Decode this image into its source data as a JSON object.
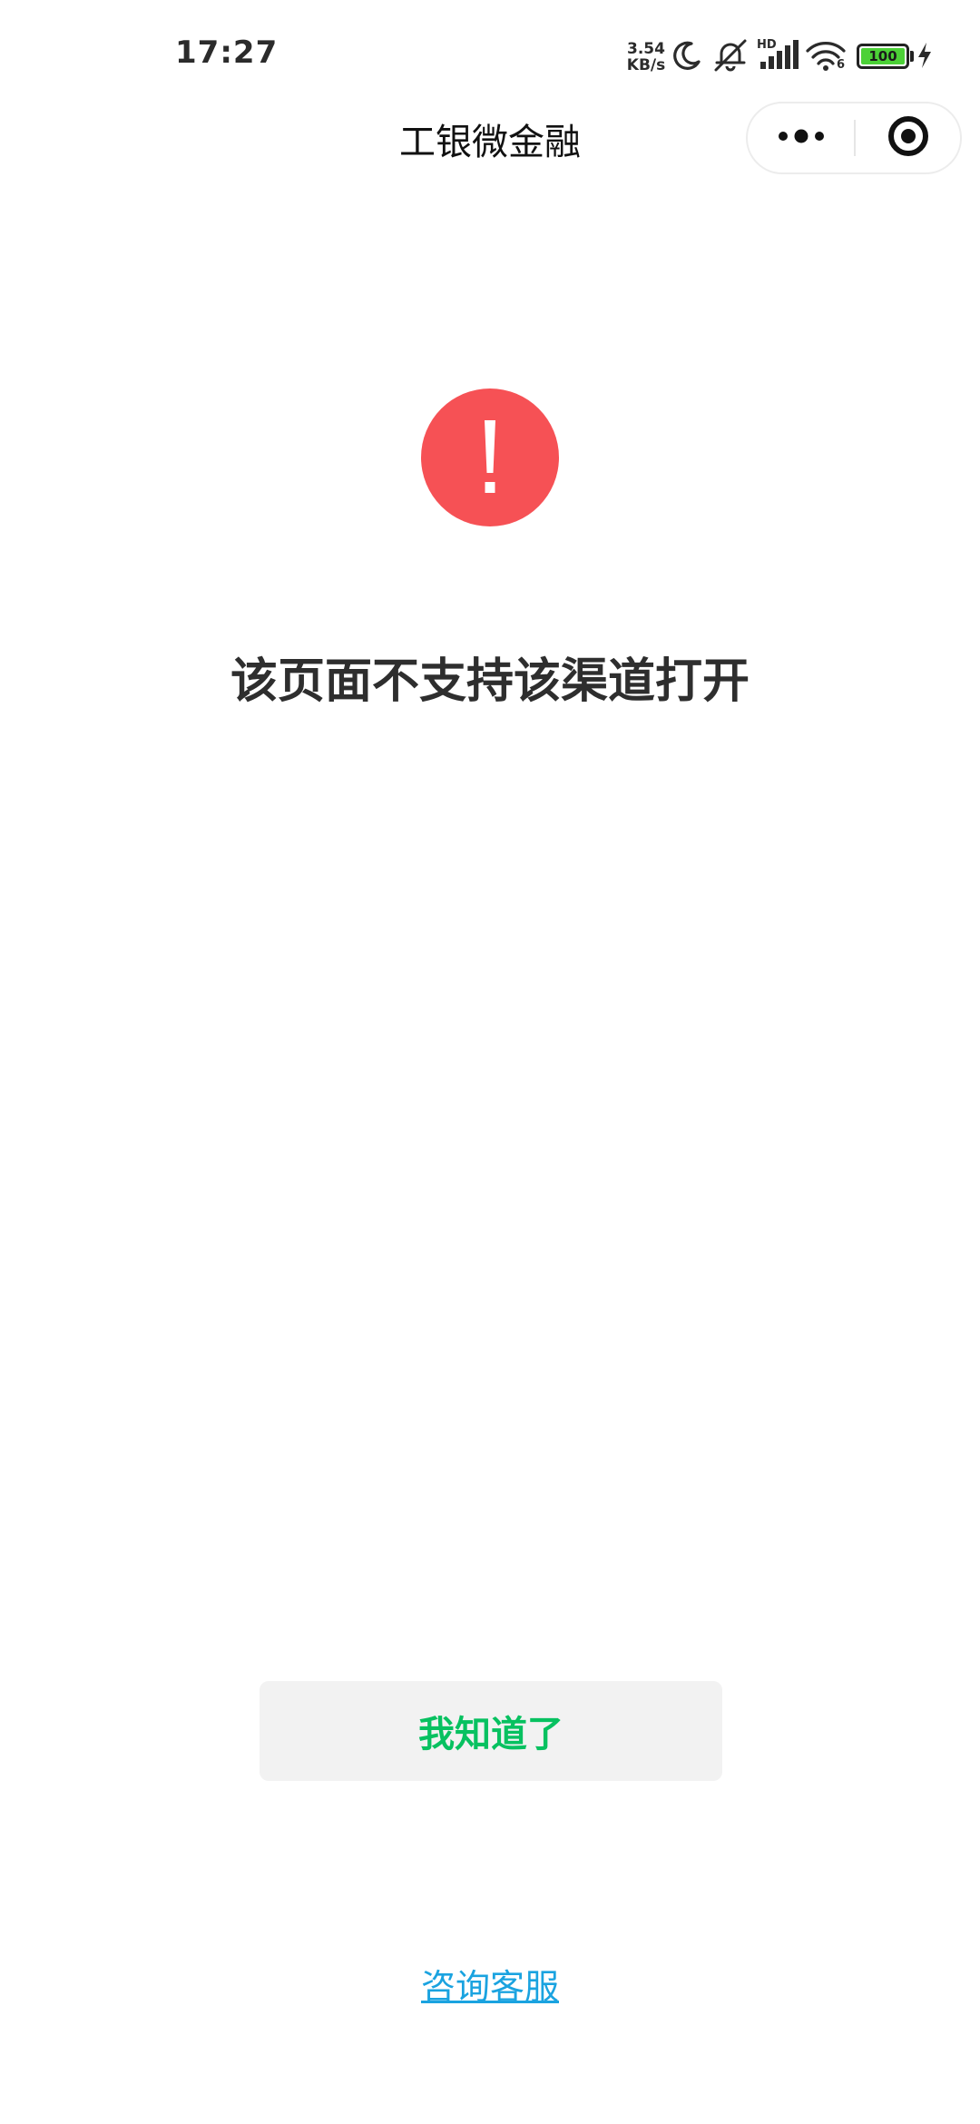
{
  "status_bar": {
    "time": "17:27",
    "net_speed_value": "3.54",
    "net_speed_unit": "KB/s",
    "hd_label": "HD",
    "wifi_sub": "6",
    "battery_level": "100",
    "icons": [
      "moon-icon",
      "mute-bell-icon",
      "signal-icon",
      "wifi-icon",
      "battery-icon",
      "charging-icon"
    ]
  },
  "nav": {
    "title": "工银微金融",
    "capsule_icons": [
      "more-icon",
      "close-target-icon"
    ]
  },
  "content": {
    "icon": "exclamation-icon",
    "icon_color": "#f65155",
    "message": "该页面不支持该渠道打开",
    "ok_button_label": "我知道了",
    "ok_button_color": "#07c160",
    "service_link_label": "咨询客服",
    "service_link_color": "#1aa3e0"
  }
}
